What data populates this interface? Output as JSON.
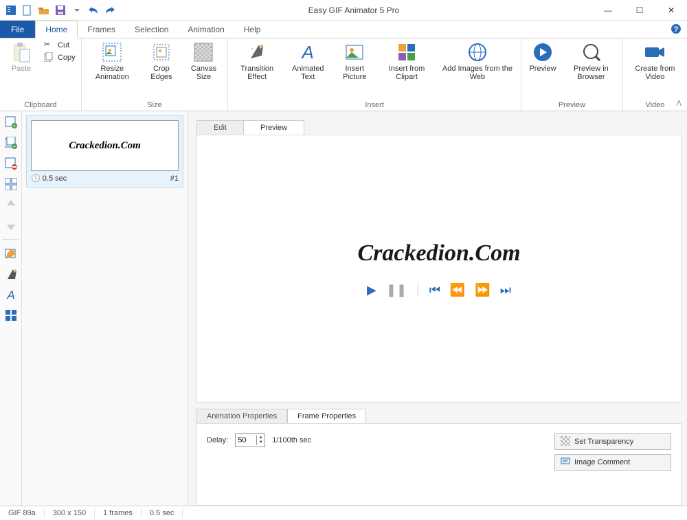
{
  "title": "Easy GIF Animator 5 Pro",
  "menu": {
    "file": "File",
    "tabs": [
      "Home",
      "Frames",
      "Selection",
      "Animation",
      "Help"
    ],
    "active": "Home"
  },
  "ribbon": {
    "clipboard": {
      "label": "Clipboard",
      "paste": "Paste",
      "cut": "Cut",
      "copy": "Copy"
    },
    "size": {
      "label": "Size",
      "resize": "Resize Animation",
      "crop": "Crop Edges",
      "canvas": "Canvas Size"
    },
    "insert": {
      "label": "Insert",
      "transition": "Transition Effect",
      "animtext": "Animated Text",
      "picture": "Insert Picture",
      "clipart": "Insert from Clipart",
      "web": "Add Images from the Web"
    },
    "preview": {
      "label": "Preview",
      "preview": "Preview",
      "browser": "Preview in Browser"
    },
    "video": {
      "label": "Video",
      "create": "Create from Video"
    }
  },
  "frames": {
    "thumb_text": "Crackedion.Com",
    "delay_display": "0.5 sec",
    "index": "#1"
  },
  "maintabs": {
    "edit": "Edit",
    "preview": "Preview"
  },
  "preview_text": "Crackedion.Com",
  "proptabs": {
    "anim": "Animation Properties",
    "frame": "Frame Properties"
  },
  "props": {
    "delay_label": "Delay:",
    "delay_value": "50",
    "delay_unit": "1/100th sec",
    "set_transparency": "Set Transparency",
    "image_comment": "Image Comment"
  },
  "status": {
    "format": "GIF 89a",
    "size": "300 x 150",
    "frames": "1 frames",
    "duration": "0.5 sec"
  }
}
